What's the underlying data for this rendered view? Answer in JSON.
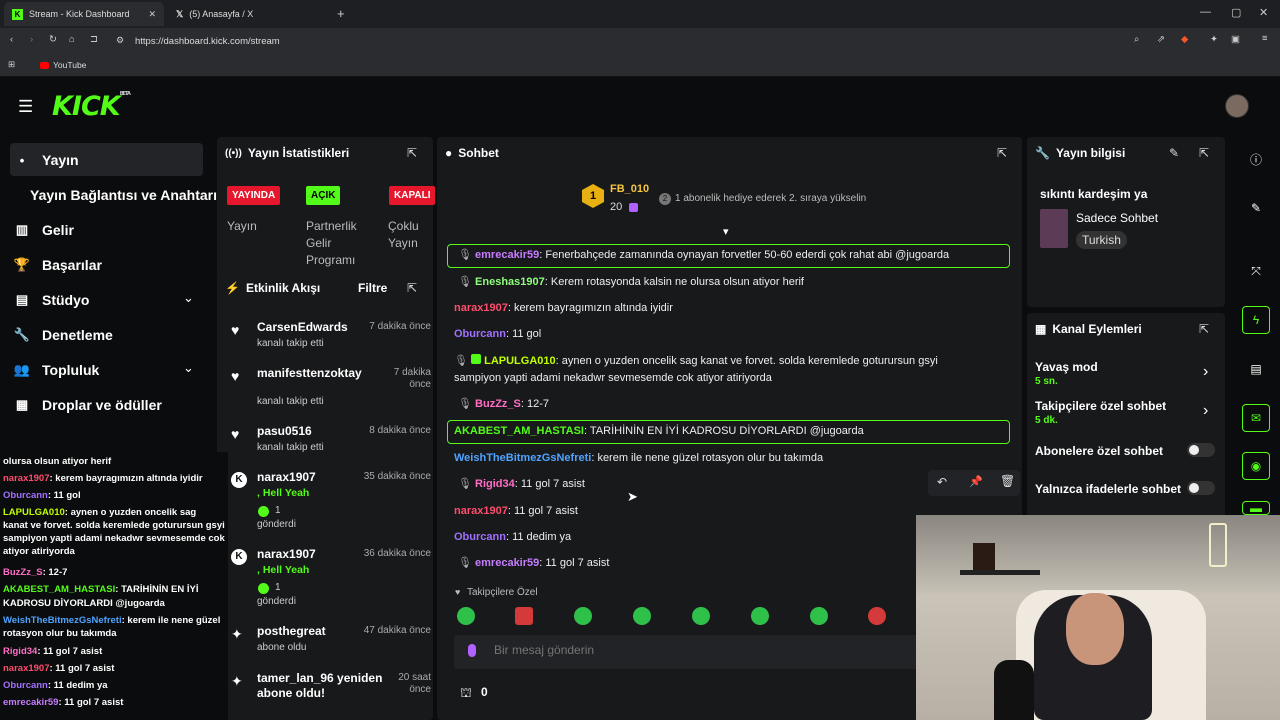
{
  "browser": {
    "tabs": [
      {
        "label": "Stream - Kick Dashboard"
      },
      {
        "label": "(5) Anasayfa / X"
      }
    ],
    "url": "https://dashboard.kick.com/stream",
    "bookmark": "YouTube"
  },
  "brand": {
    "logo": "KICK",
    "beta": "BETA",
    "accent": "#53fc18"
  },
  "sidebar": {
    "items": [
      {
        "label": "Yayın",
        "icon": "broadcast-icon"
      },
      {
        "label": "Yayın Bağlantısı ve Anahtarı"
      },
      {
        "label": "Gelir",
        "icon": "chart-icon"
      },
      {
        "label": "Başarılar",
        "icon": "trophy-icon"
      },
      {
        "label": "Stüdyo",
        "icon": "monitor-icon"
      },
      {
        "label": "Denetleme",
        "icon": "wrench-icon"
      },
      {
        "label": "Topluluk",
        "icon": "people-icon"
      },
      {
        "label": "Droplar ve ödüller",
        "icon": "gift-icon"
      }
    ]
  },
  "stats": {
    "title": "Yayın İstatistikleri",
    "badges": [
      {
        "value": "YAYINDA",
        "label": "Yayın"
      },
      {
        "value": "AÇIK",
        "label": "Partnerlik Gelir Programı"
      },
      {
        "value": "KAPALI",
        "label": "Çoklu Yayın"
      }
    ]
  },
  "activity": {
    "title": "Etkinlik Akışı",
    "filter": "Filtre",
    "items": [
      {
        "name": "CarsenEdwards",
        "sub": "kanalı takip etti",
        "time": "7 dakika önce"
      },
      {
        "name": "manifesttenzoktay",
        "sub": "kanalı takip etti",
        "time": "7 dakika önce"
      },
      {
        "name": "pasu0516",
        "sub": "kanalı takip etti",
        "time": "8 dakika önce"
      },
      {
        "name": "narax1907",
        "extra": ", Hell Yeah",
        "count": "1",
        "sub": "gönderdi",
        "time": "35 dakika önce"
      },
      {
        "name": "narax1907",
        "extra": ", Hell Yeah",
        "count": "1",
        "sub": "gönderdi",
        "time": "36 dakika önce"
      },
      {
        "name": "posthegreat",
        "sub": "abone oldu",
        "time": "47 dakika önce"
      },
      {
        "name": "tamer_lan_96 yeniden abone oldu!",
        "sub": "",
        "time": "20 saat önce"
      }
    ]
  },
  "chat": {
    "title": "Sohbet",
    "leader": {
      "name": "FB_010",
      "rank": "1",
      "count": "20",
      "hint": "1 abonelik hediye ederek 2. sıraya yükselin"
    },
    "messages": [
      {
        "user": "emrecakir59",
        "text": ": Fenerbahçede zamanında oynayan forvetler 50-60 ederdi çok rahat abi @jugoarda",
        "color": "#c77dff"
      },
      {
        "user": "Eneshas1907",
        "text": ": Kerem rotasyonda kalsin ne olursa olsun atiyor herif",
        "color": "#8dff7a"
      },
      {
        "user": "narax1907",
        "text": ": kerem bayragımızın altında iyidir",
        "color": "#ff4d6d"
      },
      {
        "user": "Oburcann",
        "text": ": 11 gol",
        "color": "#a070ff"
      },
      {
        "user": "LAPULGA010",
        "text": ": aynen o yuzden oncelik sag kanat ve forvet. solda keremlede goturursun gsyi",
        "text2": "sampiyon yapti adami nekadwr sevmesemde cok atiyor atiriyorda",
        "color": "#c0ff00"
      },
      {
        "user": "BuzZz_S",
        "text": ": 12-7",
        "color": "#ff6ec7"
      },
      {
        "user": "AKABEST_AM_HASTASI",
        "text": ": TARİHİNİN EN İYİ KADROSU DİYORLARDI @jugoarda",
        "color": "#53fc18"
      },
      {
        "user": "WeishTheBitmezGsNefreti",
        "text": ": kerem ile nene güzel rotasyon olur bu takımda",
        "color": "#4fa3ff"
      },
      {
        "user": "Rigid34",
        "text": ": 11 gol 7 asist",
        "color": "#ff6ec7"
      },
      {
        "user": "narax1907",
        "text": ": 11 gol 7 asist",
        "color": "#ff4d6d"
      },
      {
        "user": "Oburcann",
        "text": ": 11 dedim ya",
        "color": "#a070ff"
      },
      {
        "user": "emrecakir59",
        "text": ": 11 gol 7 asist",
        "color": "#c77dff"
      }
    ],
    "follower_only": "Takipçilere Özel",
    "placeholder": "Bir mesaj gönderin",
    "points": "0"
  },
  "info": {
    "title": "Yayın bilgisi",
    "stream_title": "sıkıntı kardeşim ya",
    "category": "Sadece Sohbet",
    "language": "Turkish"
  },
  "actions": {
    "title": "Kanal Eylemleri",
    "items": [
      {
        "label": "Yavaş mod",
        "value": "5 sn."
      },
      {
        "label": "Takipçilere özel sohbet",
        "value": "5 dk."
      },
      {
        "label": "Abonelere özel sohbet"
      },
      {
        "label": "Yalnızca ifadelerle sohbet"
      }
    ]
  },
  "overlay": {
    "lines": [
      {
        "user": "",
        "text": "olursa olsun atiyor herif",
        "color": "#fff"
      },
      {
        "user": "narax1907",
        "text": ": kerem bayragımızın altında iyidir",
        "color": "#ff4d6d"
      },
      {
        "user": "Oburcann",
        "text": ": 11 gol",
        "color": "#a070ff"
      },
      {
        "user": "LAPULGA010",
        "text": ": aynen o yuzden oncelik sag",
        "color": "#c0ff00"
      },
      {
        "user": "",
        "text": "kanat ve forvet. solda keremlede goturursun gsyi",
        "color": "#fff"
      },
      {
        "user": "",
        "text": "sampiyon yapti adami nekadwr sevmesemde cok",
        "color": "#fff"
      },
      {
        "user": "",
        "text": "atiyor atiriyorda",
        "color": "#fff"
      },
      {
        "user": "BuzZz_S",
        "text": ": 12-7",
        "color": "#ff6ec7"
      },
      {
        "user": "AKABEST_AM_HASTASI",
        "text": ": TARİHİNİN EN İYİ",
        "color": "#53fc18"
      },
      {
        "user": "",
        "text": "KADROSU DİYORLARDI @jugoarda",
        "color": "#fff"
      },
      {
        "user": "WeishTheBitmezGsNefreti",
        "text": ": kerem ile nene güzel",
        "color": "#4fa3ff"
      },
      {
        "user": "",
        "text": "rotasyon olur bu takımda",
        "color": "#fff"
      },
      {
        "user": "Rigid34",
        "text": ": 11 gol 7 asist",
        "color": "#ff6ec7"
      },
      {
        "user": "narax1907",
        "text": ": 11 gol 7 asist",
        "color": "#ff4d6d"
      },
      {
        "user": "Oburcann",
        "text": ": 11 dedim ya",
        "color": "#a070ff"
      },
      {
        "user": "emrecakir59",
        "text": ": 11 gol 7 asist",
        "color": "#c77dff"
      }
    ]
  }
}
